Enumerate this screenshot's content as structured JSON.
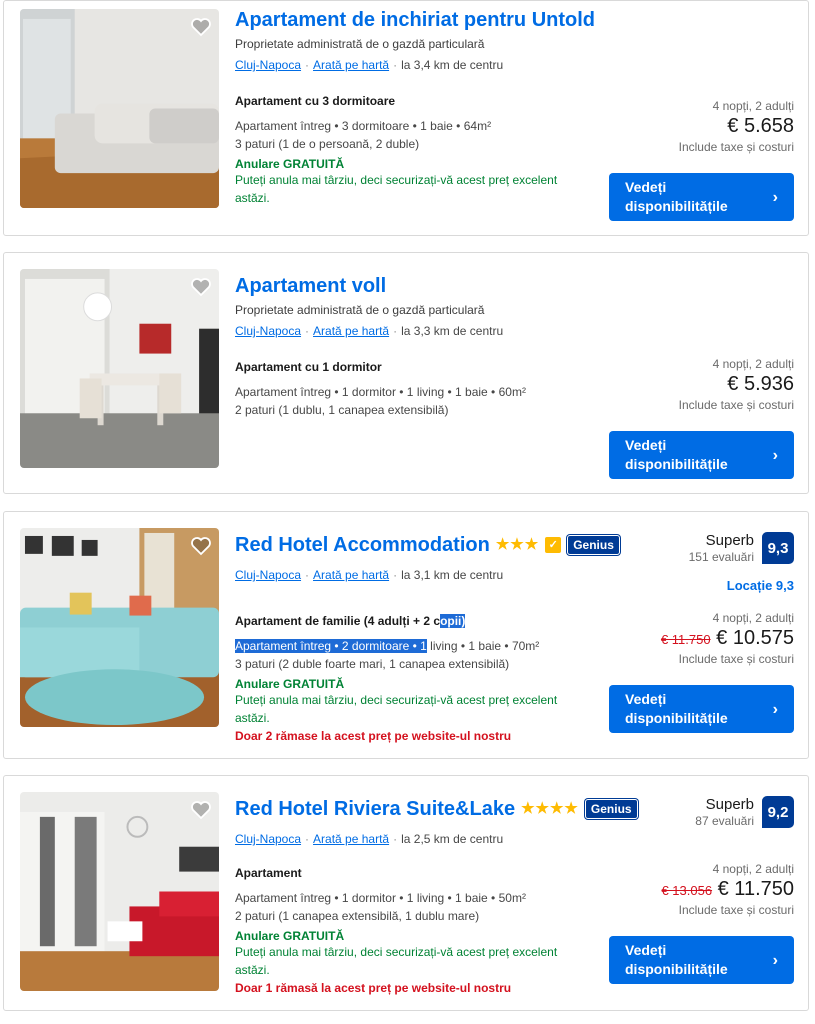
{
  "listings": [
    {
      "title": "Apartament de inchiriat pentru Untold",
      "subtitle": "Proprietate administrată de o gazdă particulară",
      "city": "Cluj-Napoca",
      "map_link": "Arată pe hartă",
      "distance": "la 3,4 km de centru",
      "room_type": "Apartament cu 3 dormitoare",
      "details_line1": "Apartament întreg • 3 dormitoare • 1 baie • 64m²",
      "details_line2": "3 paturi (1 de o persoană, 2 duble)",
      "cancel": "Anulare GRATUITĂ",
      "cancel_note": "Puteți anula mai târziu, deci securizați-vă acest preț excelent astăzi.",
      "nights": "4 nopți, 2 adulți",
      "price": "€ 5.658",
      "taxes": "Include taxe și costuri",
      "button": "Vedeți disponibilitățile"
    },
    {
      "title": "Apartament voll",
      "subtitle": "Proprietate administrată de o gazdă particulară",
      "city": "Cluj-Napoca",
      "map_link": "Arată pe hartă",
      "distance": "la 3,3 km de centru",
      "room_type": "Apartament cu 1 dormitor",
      "details_line1": "Apartament întreg • 1 dormitor • 1 living • 1 baie • 60m²",
      "details_line2": "2 paturi (1 dublu, 1 canapea extensibilă)",
      "nights": "4 nopți, 2 adulți",
      "price": "€ 5.936",
      "taxes": "Include taxe și costuri",
      "button": "Vedeți disponibilitățile"
    },
    {
      "title": "Red Hotel Accommodation",
      "stars": "★★★",
      "thumb": "👍",
      "genius": "Genius",
      "city": "Cluj-Napoca",
      "map_link": "Arată pe hartă",
      "distance": "la 3,1 km de centru",
      "review_label": "Superb",
      "review_count": "151 evaluări",
      "score": "9,3",
      "location_score": "Locație 9,3",
      "room_type_a": "Apartament de familie (4 adulți + 2 c",
      "room_type_b": "opii)",
      "details_line1_a": "Apartament întreg • 2 dormitoare • 1",
      "details_line1_b": " living • 1 baie • 70m²",
      "details_line2": "3 paturi (2 duble foarte mari, 1 canapea extensibilă)",
      "cancel": "Anulare GRATUITĂ",
      "cancel_note": "Puteți anula mai târziu, deci securizați-vă acest preț excelent astăzi.",
      "urgency": "Doar 2 rămase la acest preț pe website-ul nostru",
      "nights": "4 nopți, 2 adulți",
      "old_price": "€ 11.750",
      "price": "€ 10.575",
      "taxes": "Include taxe și costuri",
      "button": "Vedeți disponibilitățile"
    },
    {
      "title": "Red Hotel Riviera Suite&Lake",
      "stars": "★★★★",
      "genius": "Genius",
      "city": "Cluj-Napoca",
      "map_link": "Arată pe hartă",
      "distance": "la 2,5 km de centru",
      "review_label": "Superb",
      "review_count": "87 evaluări",
      "score": "9,2",
      "room_type": "Apartament",
      "details_line1": "Apartament întreg • 1 dormitor • 1 living • 1 baie • 50m²",
      "details_line2": "2 paturi (1 canapea extensibilă, 1 dublu mare)",
      "cancel": "Anulare GRATUITĂ",
      "cancel_note": "Puteți anula mai târziu, deci securizați-vă acest preț excelent astăzi.",
      "urgency": "Doar 1 rămasă la acest preț pe website-ul nostru",
      "nights": "4 nopți, 2 adulți",
      "old_price": "€ 13.056",
      "price": "€ 11.750",
      "taxes": "Include taxe și costuri",
      "button": "Vedeți disponibilitățile"
    }
  ],
  "icons": {
    "wishlist": "heart-icon",
    "chevron": "chevron-right-icon"
  },
  "colors": {
    "link": "#006ce4",
    "button": "#006ce4",
    "score": "#003b95",
    "green": "#008234",
    "red": "#d4111e",
    "stars": "#febb02"
  }
}
